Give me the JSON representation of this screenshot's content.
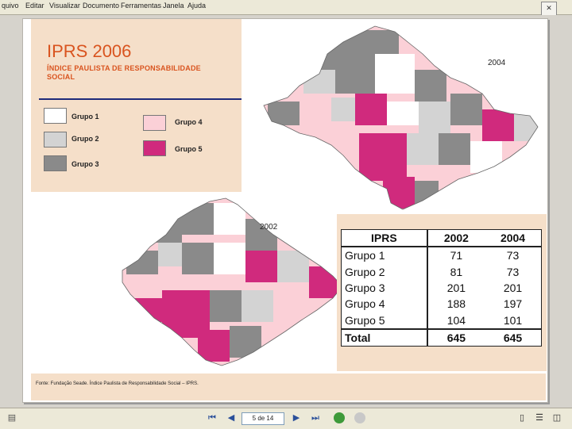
{
  "menu": {
    "items": [
      "quivo",
      "Editar",
      "Visualizar",
      "Documento",
      "Ferramentas",
      "Janela",
      "Ajuda"
    ]
  },
  "slide": {
    "title": "IPRS 2006",
    "subtitle": "ÍNDICE PAULISTA DE RESPONSABILIDADE SOCIAL",
    "legend": [
      {
        "label": "Grupo 1",
        "color": "#ffffff"
      },
      {
        "label": "Grupo 2",
        "color": "#d3d3d3"
      },
      {
        "label": "Grupo 3",
        "color": "#8a8a8a"
      },
      {
        "label": "Grupo 4",
        "color": "#fbd0d7"
      },
      {
        "label": "Grupo 5",
        "color": "#d02a7d"
      }
    ],
    "map_label_2004": "2004",
    "map_label_2002": "2002",
    "table": {
      "headers": [
        "IPRS",
        "2002",
        "2004"
      ],
      "rows": [
        {
          "group": "Grupo 1",
          "y2002": "71",
          "y2004": "73"
        },
        {
          "group": "Grupo 2",
          "y2002": "81",
          "y2004": "73"
        },
        {
          "group": "Grupo 3",
          "y2002": "201",
          "y2004": "201"
        },
        {
          "group": "Grupo 4",
          "y2002": "188",
          "y2004": "197"
        },
        {
          "group": "Grupo 5",
          "y2002": "104",
          "y2004": "101"
        }
      ],
      "total": {
        "group": "Total",
        "y2002": "645",
        "y2004": "645"
      }
    },
    "footer": "Fonte: Fundação Seade. Índice Paulista de Responsabilidade Social – IPRS."
  },
  "navigation": {
    "page_indicator": "5 de 14"
  },
  "colors": {
    "accent_orange": "#d9541f",
    "panel_bg": "#f5dfc9",
    "divider_blue": "#1e2a7a"
  }
}
